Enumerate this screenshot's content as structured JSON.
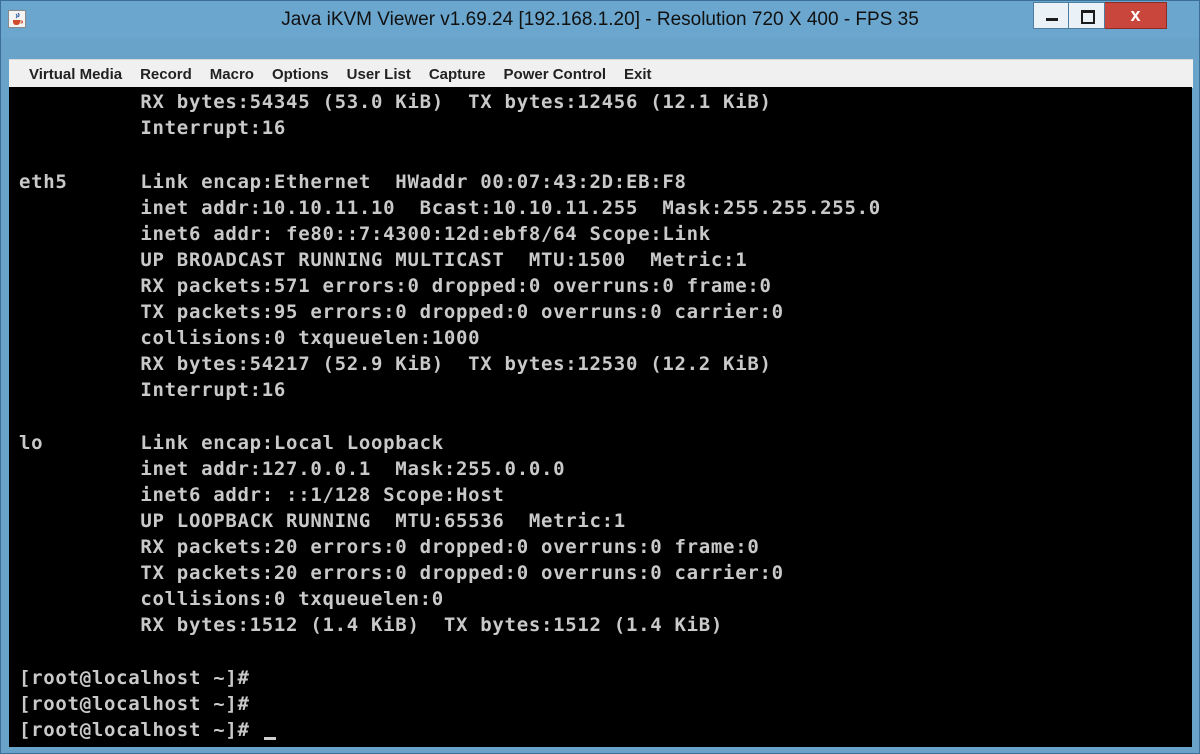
{
  "window": {
    "title": "Java iKVM Viewer v1.69.24 [192.168.1.20]  - Resolution 720 X 400 - FPS 35",
    "icon": "java-cup-icon",
    "controls": {
      "minimize": "minimize-icon",
      "maximize": "maximize-icon",
      "close_label": "x"
    }
  },
  "menu": {
    "items": [
      "Virtual Media",
      "Record",
      "Macro",
      "Options",
      "User List",
      "Capture",
      "Power Control",
      "Exit"
    ]
  },
  "terminal": {
    "lines": [
      "          RX bytes:54345 (53.0 KiB)  TX bytes:12456 (12.1 KiB)",
      "          Interrupt:16",
      "",
      "eth5      Link encap:Ethernet  HWaddr 00:07:43:2D:EB:F8",
      "          inet addr:10.10.11.10  Bcast:10.10.11.255  Mask:255.255.255.0",
      "          inet6 addr: fe80::7:4300:12d:ebf8/64 Scope:Link",
      "          UP BROADCAST RUNNING MULTICAST  MTU:1500  Metric:1",
      "          RX packets:571 errors:0 dropped:0 overruns:0 frame:0",
      "          TX packets:95 errors:0 dropped:0 overruns:0 carrier:0",
      "          collisions:0 txqueuelen:1000",
      "          RX bytes:54217 (52.9 KiB)  TX bytes:12530 (12.2 KiB)",
      "          Interrupt:16",
      "",
      "lo        Link encap:Local Loopback",
      "          inet addr:127.0.0.1  Mask:255.0.0.0",
      "          inet6 addr: ::1/128 Scope:Host",
      "          UP LOOPBACK RUNNING  MTU:65536  Metric:1",
      "          RX packets:20 errors:0 dropped:0 overruns:0 frame:0",
      "          TX packets:20 errors:0 dropped:0 overruns:0 carrier:0",
      "          collisions:0 txqueuelen:0",
      "          RX bytes:1512 (1.4 KiB)  TX bytes:1512 (1.4 KiB)",
      "",
      "[root@localhost ~]#",
      "[root@localhost ~]#",
      "[root@localhost ~]# "
    ]
  },
  "colors": {
    "title_bar": "#6aa6ce",
    "close_button": "#c9463d",
    "terminal_bg": "#000000",
    "terminal_fg": "#c9c9c9"
  }
}
